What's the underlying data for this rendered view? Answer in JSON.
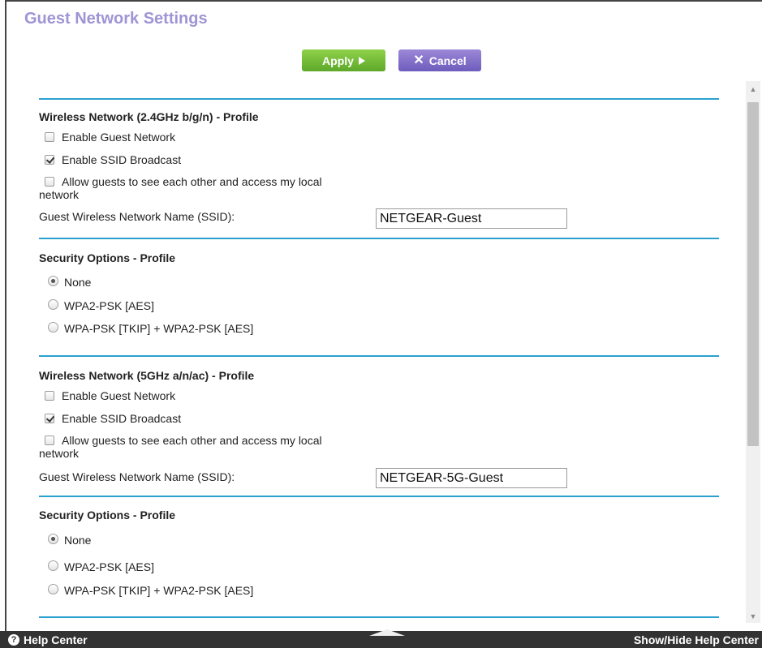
{
  "page": {
    "title": "Guest Network Settings"
  },
  "actions": {
    "apply_label": "Apply",
    "cancel_label": "Cancel"
  },
  "sections": {
    "wireless24": {
      "heading": "Wireless Network (2.4GHz b/g/n) - Profile",
      "enable_guest": {
        "label": "Enable Guest Network",
        "checked": false
      },
      "ssid_broadcast": {
        "label": "Enable SSID Broadcast",
        "checked": true
      },
      "allow_guests_line1": "Allow guests to see each other and access my local",
      "allow_guests_line2": "network",
      "ssid_label": "Guest Wireless Network Name (SSID):",
      "ssid_value": "NETGEAR-Guest"
    },
    "security24": {
      "heading": "Security Options - Profile",
      "options": [
        "None",
        "WPA2-PSK [AES]",
        "WPA-PSK [TKIP] + WPA2-PSK [AES]"
      ],
      "selected": "None"
    },
    "wireless5": {
      "heading": "Wireless Network (5GHz a/n/ac) - Profile",
      "enable_guest": {
        "label": "Enable Guest Network",
        "checked": false
      },
      "ssid_broadcast": {
        "label": "Enable SSID Broadcast",
        "checked": true
      },
      "allow_guests_line1": "Allow guests to see each other and access my local",
      "allow_guests_line2": "network",
      "ssid_label": "Guest Wireless Network Name (SSID):",
      "ssid_value": "NETGEAR-5G-Guest"
    },
    "security5": {
      "heading": "Security Options - Profile",
      "options": [
        "None",
        "WPA2-PSK [AES]",
        "WPA-PSK [TKIP] + WPA2-PSK [AES]"
      ],
      "selected": "None"
    }
  },
  "footer": {
    "help_center": "Help Center",
    "toggle_help": "Show/Hide Help Center"
  },
  "colors": {
    "title": "#9f94d4",
    "apply": "#6cb934",
    "cancel": "#7b68c8",
    "divider": "#2aa0cf",
    "footer": "#333333"
  }
}
